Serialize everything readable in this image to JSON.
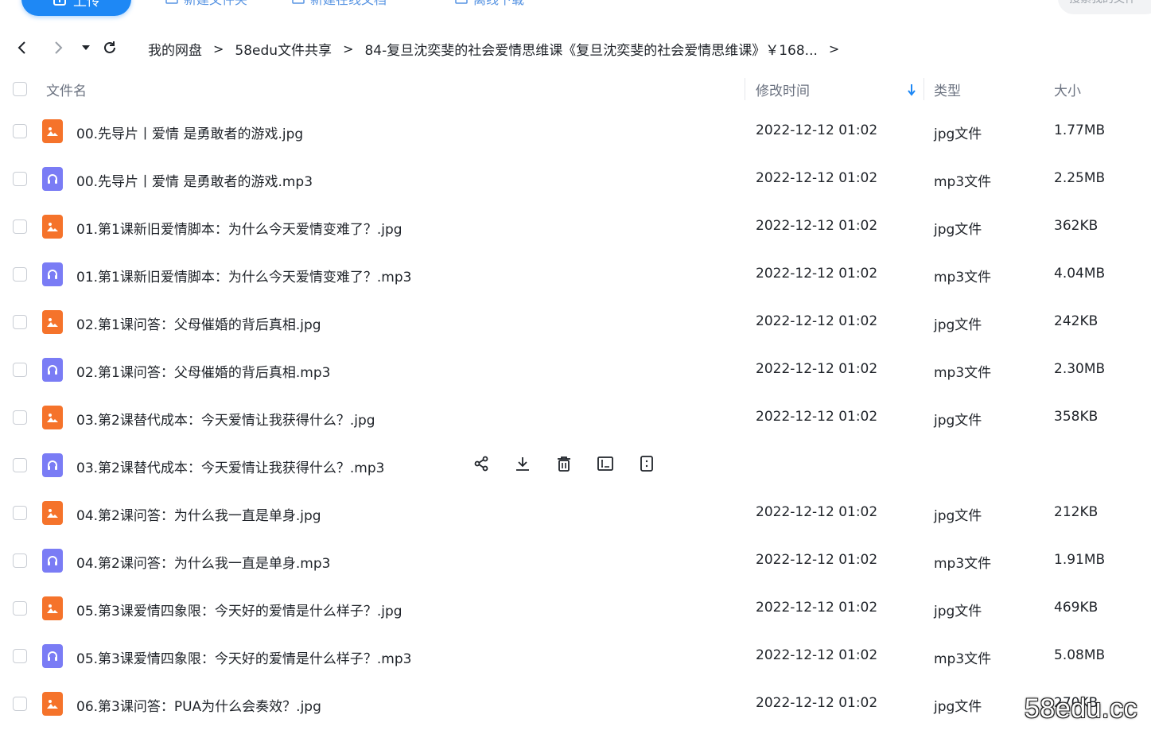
{
  "toolbar": {
    "upload_label": "上传",
    "new_folder_label": "新建文件夹",
    "new_online_doc_label": "新建在线文档",
    "offline_download_label": "离线下载",
    "search_placeholder": "搜索我的文件"
  },
  "breadcrumb": {
    "items": [
      "我的网盘",
      "58edu文件共享",
      "84-复旦沈奕斐的社会爱情思维课《复旦沈奕斐的社会爱情思维课》￥168..."
    ]
  },
  "table": {
    "headers": {
      "name": "文件名",
      "modified": "修改时间",
      "type": "类型",
      "size": "大小"
    },
    "rows": [
      {
        "name": "00.先导片丨爱情 是勇敢者的游戏.jpg",
        "date": "2022-12-12 01:02",
        "type": "jpg文件",
        "size": "1.77MB",
        "icon": "image"
      },
      {
        "name": "00.先导片丨爱情 是勇敢者的游戏.mp3",
        "date": "2022-12-12 01:02",
        "type": "mp3文件",
        "size": "2.25MB",
        "icon": "audio"
      },
      {
        "name": "01.第1课新旧爱情脚本：为什么今天爱情变难了？.jpg",
        "date": "2022-12-12 01:02",
        "type": "jpg文件",
        "size": "362KB",
        "icon": "image"
      },
      {
        "name": "01.第1课新旧爱情脚本：为什么今天爱情变难了？.mp3",
        "date": "2022-12-12 01:02",
        "type": "mp3文件",
        "size": "4.04MB",
        "icon": "audio"
      },
      {
        "name": "02.第1课问答：父母催婚的背后真相.jpg",
        "date": "2022-12-12 01:02",
        "type": "jpg文件",
        "size": "242KB",
        "icon": "image"
      },
      {
        "name": "02.第1课问答：父母催婚的背后真相.mp3",
        "date": "2022-12-12 01:02",
        "type": "mp3文件",
        "size": "2.30MB",
        "icon": "audio"
      },
      {
        "name": "03.第2课替代成本：今天爱情让我获得什么？.jpg",
        "date": "2022-12-12 01:02",
        "type": "jpg文件",
        "size": "358KB",
        "icon": "image"
      },
      {
        "name": "03.第2课替代成本：今天爱情让我获得什么？.mp3",
        "date": "",
        "type": "",
        "size": "",
        "icon": "audio",
        "hovered": true
      },
      {
        "name": "04.第2课问答：为什么我一直是单身.jpg",
        "date": "2022-12-12 01:02",
        "type": "jpg文件",
        "size": "212KB",
        "icon": "image"
      },
      {
        "name": "04.第2课问答：为什么我一直是单身.mp3",
        "date": "2022-12-12 01:02",
        "type": "mp3文件",
        "size": "1.91MB",
        "icon": "audio"
      },
      {
        "name": "05.第3课爱情四象限：今天好的爱情是什么样子？.jpg",
        "date": "2022-12-12 01:02",
        "type": "jpg文件",
        "size": "469KB",
        "icon": "image"
      },
      {
        "name": "05.第3课爱情四象限：今天好的爱情是什么样子？.mp3",
        "date": "2022-12-12 01:02",
        "type": "mp3文件",
        "size": "5.08MB",
        "icon": "audio"
      },
      {
        "name": "06.第3课问答：PUA为什么会奏效？.jpg",
        "date": "2022-12-12 01:02",
        "type": "jpg文件",
        "size": "270KB",
        "icon": "image"
      }
    ]
  },
  "row_actions": [
    "share-icon",
    "download-icon",
    "delete-icon",
    "rename-icon",
    "more-icon"
  ],
  "watermark": "58edu.cc",
  "colors": {
    "accent": "#1e88f5",
    "image_icon": "#f5732b",
    "audio_icon": "#7a7cf5"
  }
}
